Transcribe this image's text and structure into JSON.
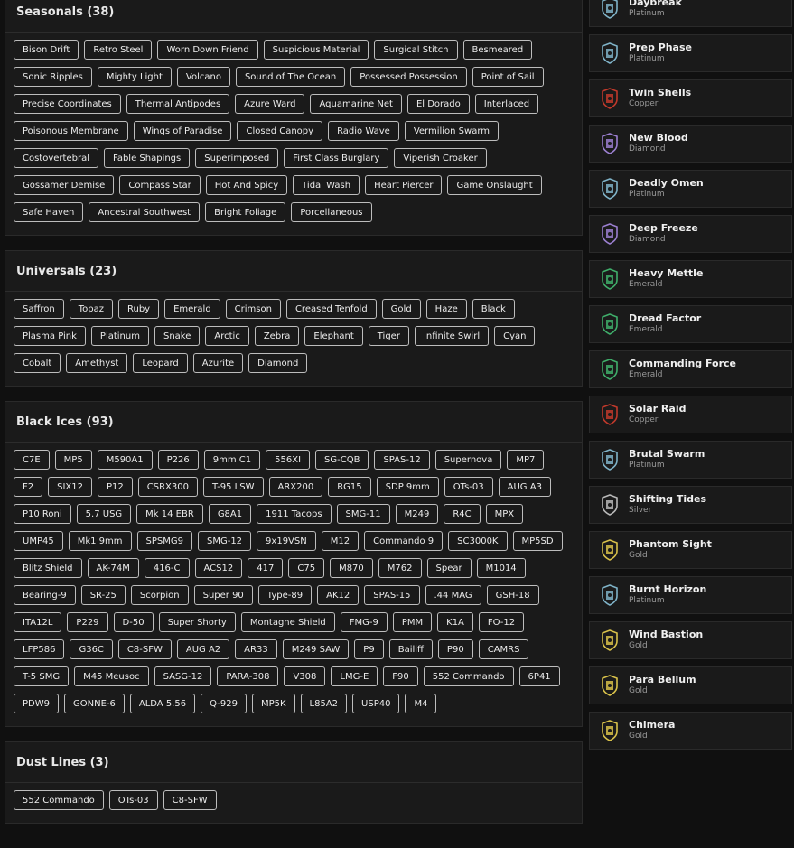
{
  "sections": [
    {
      "title": "Seasonals (38)",
      "items": [
        "Bison Drift",
        "Retro Steel",
        "Worn Down Friend",
        "Suspicious Material",
        "Surgical Stitch",
        "Besmeared",
        "Sonic Ripples",
        "Mighty Light",
        "Volcano",
        "Sound of The Ocean",
        "Possessed Possession",
        "Point of Sail",
        "Precise Coordinates",
        "Thermal Antipodes",
        "Azure Ward",
        "Aquamarine Net",
        "El Dorado",
        "Interlaced",
        "Poisonous Membrane",
        "Wings of Paradise",
        "Closed Canopy",
        "Radio Wave",
        "Vermilion Swarm",
        "Costovertebral",
        "Fable Shapings",
        "Superimposed",
        "First Class Burglary",
        "Viperish Croaker",
        "Gossamer Demise",
        "Compass Star",
        "Hot And Spicy",
        "Tidal Wash",
        "Heart Piercer",
        "Game Onslaught",
        "Safe Haven",
        "Ancestral Southwest",
        "Bright Foliage",
        "Porcellaneous"
      ]
    },
    {
      "title": "Universals (23)",
      "items": [
        "Saffron",
        "Topaz",
        "Ruby",
        "Emerald",
        "Crimson",
        "Creased Tenfold",
        "Gold",
        "Haze",
        "Black",
        "Plasma Pink",
        "Platinum",
        "Snake",
        "Arctic",
        "Zebra",
        "Elephant",
        "Tiger",
        "Infinite Swirl",
        "Cyan",
        "Cobalt",
        "Amethyst",
        "Leopard",
        "Azurite",
        "Diamond"
      ]
    },
    {
      "title": "Black Ices (93)",
      "items": [
        "C7E",
        "MP5",
        "M590A1",
        "P226",
        "9mm C1",
        "556XI",
        "SG-CQB",
        "SPAS-12",
        "Supernova",
        "MP7",
        "F2",
        "SIX12",
        "P12",
        "CSRX300",
        "T-95 LSW",
        "ARX200",
        "RG15",
        "SDP 9mm",
        "OTs-03",
        "AUG A3",
        "P10 Roni",
        "5.7 USG",
        "Mk 14 EBR",
        "G8A1",
        "1911 Tacops",
        "SMG-11",
        "M249",
        "R4C",
        "MPX",
        "UMP45",
        "Mk1 9mm",
        "SPSMG9",
        "SMG-12",
        "9x19VSN",
        "M12",
        "Commando 9",
        "SC3000K",
        "MP5SD",
        "Blitz Shield",
        "AK-74M",
        "416-C",
        "ACS12",
        "417",
        "C75",
        "M870",
        "M762",
        "Spear",
        "M1014",
        "Bearing-9",
        "SR-25",
        "Scorpion",
        "Super 90",
        "Type-89",
        "AK12",
        "SPAS-15",
        ".44 MAG",
        "GSH-18",
        "ITA12L",
        "P229",
        "D-50",
        "Super Shorty",
        "Montagne Shield",
        "FMG-9",
        "PMM",
        "K1A",
        "FO-12",
        "LFP586",
        "G36C",
        "C8-SFW",
        "AUG A2",
        "AR33",
        "M249 SAW",
        "P9",
        "Bailiff",
        "P90",
        "CAMRS",
        "T-5 SMG",
        "M45 Meusoc",
        "SASG-12",
        "PARA-308",
        "V308",
        "LMG-E",
        "F90",
        "552 Commando",
        "6P41",
        "PDW9",
        "GONNE-6",
        "ALDA 5.56",
        "Q-929",
        "MP5K",
        "L85A2",
        "USP40",
        "M4"
      ]
    },
    {
      "title": "Dust Lines (3)",
      "items": [
        "552 Commando",
        "OTs-03",
        "C8-SFW"
      ]
    }
  ],
  "achievements": [
    {
      "name": "Daybreak",
      "rank": "Platinum",
      "color": "#7fb3c8"
    },
    {
      "name": "Prep Phase",
      "rank": "Platinum",
      "color": "#7fb3c8"
    },
    {
      "name": "Twin Shells",
      "rank": "Copper",
      "color": "#c0392b"
    },
    {
      "name": "New Blood",
      "rank": "Diamond",
      "color": "#9b7fd0"
    },
    {
      "name": "Deadly Omen",
      "rank": "Platinum",
      "color": "#7fb3c8"
    },
    {
      "name": "Deep Freeze",
      "rank": "Diamond",
      "color": "#9b7fd0"
    },
    {
      "name": "Heavy Mettle",
      "rank": "Emerald",
      "color": "#3fae6a"
    },
    {
      "name": "Dread Factor",
      "rank": "Emerald",
      "color": "#3fae6a"
    },
    {
      "name": "Commanding Force",
      "rank": "Emerald",
      "color": "#3fae6a"
    },
    {
      "name": "Solar Raid",
      "rank": "Copper",
      "color": "#c0392b"
    },
    {
      "name": "Brutal Swarm",
      "rank": "Platinum",
      "color": "#7fb3c8"
    },
    {
      "name": "Shifting Tides",
      "rank": "Silver",
      "color": "#b9b9b9"
    },
    {
      "name": "Phantom Sight",
      "rank": "Gold",
      "color": "#d8c14a"
    },
    {
      "name": "Burnt Horizon",
      "rank": "Platinum",
      "color": "#7fb3c8"
    },
    {
      "name": "Wind Bastion",
      "rank": "Gold",
      "color": "#d8c14a"
    },
    {
      "name": "Para Bellum",
      "rank": "Gold",
      "color": "#d8c14a"
    },
    {
      "name": "Chimera",
      "rank": "Gold",
      "color": "#d8c14a"
    }
  ]
}
